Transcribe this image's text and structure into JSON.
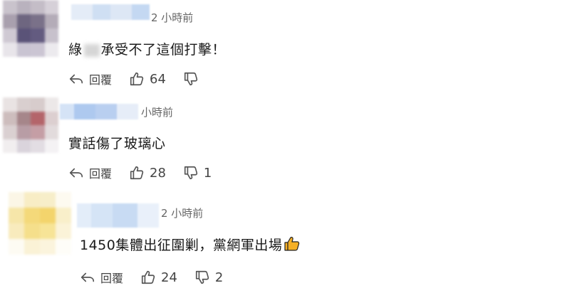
{
  "comments": [
    {
      "time": "2 小時前",
      "text_before": "綠",
      "text_after": "承受不了這個打擊！",
      "actions": {
        "reply_label": "回覆",
        "likes": "64",
        "dislikes": ""
      }
    },
    {
      "time": "小時前",
      "text": "實話傷了玻璃心",
      "actions": {
        "reply_label": "回覆",
        "likes": "28",
        "dislikes": "1"
      }
    },
    {
      "time": "2 小時前",
      "text": "1450集體出征圍剿，黨網軍出場",
      "emoji": "thumbs-up",
      "actions": {
        "reply_label": "回覆",
        "likes": "24",
        "dislikes": "2"
      }
    }
  ],
  "icons": [
    "reply-icon",
    "thumbs-up-icon",
    "thumbs-down-icon",
    "thumbs-up-emoji-icon"
  ],
  "colors": {
    "text": "#1a1a1a",
    "muted": "#666666",
    "icon": "#555555",
    "emoji": "#f5b027"
  }
}
